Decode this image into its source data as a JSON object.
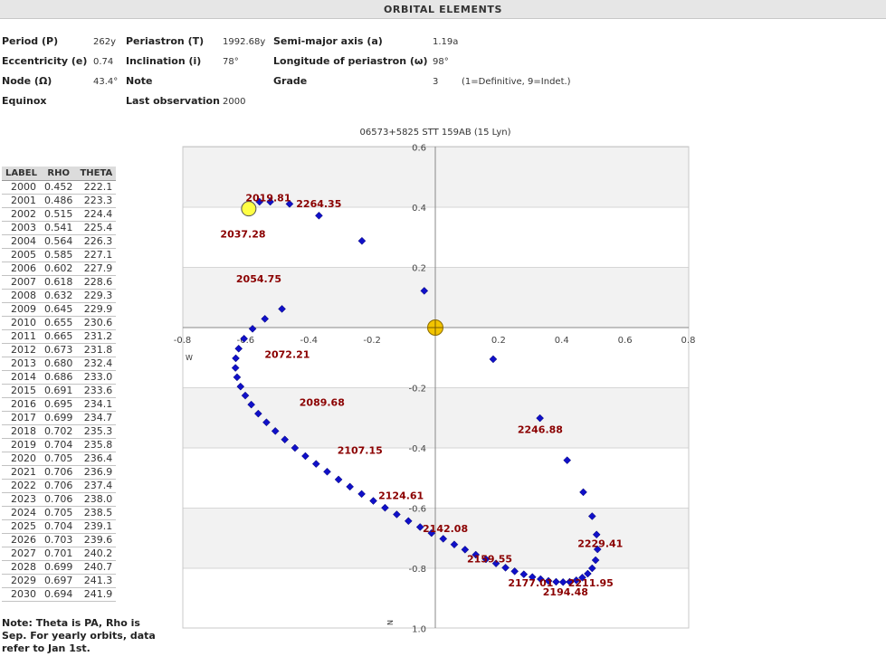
{
  "header": {
    "title": "ORBITAL ELEMENTS"
  },
  "elements": {
    "period_label": "Period (P)",
    "period_value": "262y",
    "periastron_label": "Periastron (T)",
    "periastron_value": "1992.68y",
    "semimajor_label": "Semi-major axis (a)",
    "semimajor_value": "1.19a",
    "ecc_label": "Eccentricity (e)",
    "ecc_value": "0.74",
    "incl_label": "Inclination (i)",
    "incl_value": "78°",
    "longperi_label": "Longitude of periastron (ω)",
    "longperi_value": "98°",
    "node_label": "Node (Ω)",
    "node_value": "43.4°",
    "note_label": "Note",
    "grade_label": "Grade",
    "grade_value": "3",
    "grade_note": "(1=Definitive, 9=Indet.)",
    "equinox_label": "Equinox",
    "lastobs_label": "Last observation",
    "lastobs_value": "2000"
  },
  "ephemeris": {
    "columns": [
      "LABEL",
      "RHO",
      "THETA"
    ],
    "rows": [
      [
        "2000",
        "0.452",
        "222.1"
      ],
      [
        "2001",
        "0.486",
        "223.3"
      ],
      [
        "2002",
        "0.515",
        "224.4"
      ],
      [
        "2003",
        "0.541",
        "225.4"
      ],
      [
        "2004",
        "0.564",
        "226.3"
      ],
      [
        "2005",
        "0.585",
        "227.1"
      ],
      [
        "2006",
        "0.602",
        "227.9"
      ],
      [
        "2007",
        "0.618",
        "228.6"
      ],
      [
        "2008",
        "0.632",
        "229.3"
      ],
      [
        "2009",
        "0.645",
        "229.9"
      ],
      [
        "2010",
        "0.655",
        "230.6"
      ],
      [
        "2011",
        "0.665",
        "231.2"
      ],
      [
        "2012",
        "0.673",
        "231.8"
      ],
      [
        "2013",
        "0.680",
        "232.4"
      ],
      [
        "2014",
        "0.686",
        "233.0"
      ],
      [
        "2015",
        "0.691",
        "233.6"
      ],
      [
        "2016",
        "0.695",
        "234.1"
      ],
      [
        "2017",
        "0.699",
        "234.7"
      ],
      [
        "2018",
        "0.702",
        "235.3"
      ],
      [
        "2019",
        "0.704",
        "235.8"
      ],
      [
        "2020",
        "0.705",
        "236.4"
      ],
      [
        "2021",
        "0.706",
        "236.9"
      ],
      [
        "2022",
        "0.706",
        "237.4"
      ],
      [
        "2023",
        "0.706",
        "238.0"
      ],
      [
        "2024",
        "0.705",
        "238.5"
      ],
      [
        "2025",
        "0.704",
        "239.1"
      ],
      [
        "2026",
        "0.703",
        "239.6"
      ],
      [
        "2027",
        "0.701",
        "240.2"
      ],
      [
        "2028",
        "0.699",
        "240.7"
      ],
      [
        "2029",
        "0.697",
        "241.3"
      ],
      [
        "2030",
        "0.694",
        "241.9"
      ]
    ]
  },
  "note": "Note: Theta is PA, Rho is Sep. For yearly orbits, data refer to Jan 1st.",
  "chart_data": {
    "type": "scatter",
    "title": "06573+5825 STT 159AB (15 Lyn)",
    "xlim": [
      -0.8,
      0.8
    ],
    "ylim": [
      1.0,
      -0.6
    ],
    "x_ticks": [
      -0.8,
      -0.6,
      -0.4,
      -0.2,
      0.2,
      0.4,
      0.6,
      0.8
    ],
    "y_ticks": [
      -0.6,
      0.4,
      0.2,
      -0.2,
      -0.4,
      -0.6,
      -0.8,
      1.0
    ],
    "x_tick_labels": [
      "-0.8",
      "-0.6",
      "-0.4",
      "-0.2",
      "0.2",
      "0.4",
      "0.6",
      "0.8"
    ],
    "y_tick_labels": [
      "0.6",
      "0.4",
      "0.2",
      "-0.2",
      "-0.4",
      "-0.6",
      "-0.8",
      "1.0"
    ],
    "axis_direction_labels": {
      "west": "W",
      "north": "N"
    },
    "grid": "alternating horizontal bands",
    "series": [
      {
        "points": [
          [
            -0.556,
            0.418
          ],
          [
            -0.522,
            0.418
          ],
          [
            -0.461,
            0.411
          ],
          [
            -0.368,
            0.372
          ],
          [
            -0.232,
            0.288
          ],
          [
            -0.035,
            0.122
          ],
          [
            0.183,
            -0.105
          ],
          [
            0.331,
            -0.301
          ],
          [
            0.417,
            -0.441
          ],
          [
            0.468,
            -0.547
          ],
          [
            0.496,
            -0.627
          ],
          [
            0.51,
            -0.688
          ],
          [
            0.513,
            -0.737
          ],
          [
            0.507,
            -0.773
          ],
          [
            0.496,
            -0.8
          ],
          [
            0.482,
            -0.818
          ],
          [
            0.465,
            -0.831
          ],
          [
            0.446,
            -0.84
          ],
          [
            0.425,
            -0.845
          ],
          [
            0.404,
            -0.846
          ],
          [
            0.382,
            -0.845
          ],
          [
            0.358,
            -0.842
          ],
          [
            0.333,
            -0.836
          ],
          [
            0.307,
            -0.829
          ],
          [
            0.28,
            -0.82
          ],
          [
            0.251,
            -0.81
          ],
          [
            0.222,
            -0.798
          ],
          [
            0.192,
            -0.784
          ],
          [
            0.16,
            -0.77
          ],
          [
            0.128,
            -0.755
          ],
          [
            0.094,
            -0.738
          ],
          [
            0.06,
            -0.721
          ],
          [
            0.025,
            -0.702
          ],
          [
            -0.012,
            -0.683
          ],
          [
            -0.048,
            -0.663
          ],
          [
            -0.085,
            -0.643
          ],
          [
            -0.122,
            -0.621
          ],
          [
            -0.159,
            -0.599
          ],
          [
            -0.196,
            -0.576
          ],
          [
            -0.233,
            -0.553
          ],
          [
            -0.27,
            -0.529
          ],
          [
            -0.306,
            -0.505
          ],
          [
            -0.342,
            -0.479
          ],
          [
            -0.377,
            -0.453
          ],
          [
            -0.411,
            -0.427
          ],
          [
            -0.444,
            -0.4
          ],
          [
            -0.476,
            -0.372
          ],
          [
            -0.506,
            -0.344
          ],
          [
            -0.534,
            -0.315
          ],
          [
            -0.56,
            -0.286
          ],
          [
            -0.582,
            -0.256
          ],
          [
            -0.601,
            -0.226
          ],
          [
            -0.616,
            -0.196
          ],
          [
            -0.627,
            -0.165
          ],
          [
            -0.632,
            -0.134
          ],
          [
            -0.631,
            -0.102
          ],
          [
            -0.622,
            -0.07
          ],
          [
            -0.605,
            -0.037
          ],
          [
            -0.578,
            -0.004
          ],
          [
            -0.539,
            0.029
          ],
          [
            -0.485,
            0.062
          ]
        ]
      }
    ],
    "marker_labels": [
      {
        "text": "2019.81",
        "x": -0.6,
        "y": 0.42
      },
      {
        "text": "2264.35",
        "x": -0.44,
        "y": 0.4
      },
      {
        "text": "2037.28",
        "x": -0.68,
        "y": 0.3
      },
      {
        "text": "2054.75",
        "x": -0.63,
        "y": 0.15
      },
      {
        "text": "2072.21",
        "x": -0.54,
        "y": -0.1
      },
      {
        "text": "2089.68",
        "x": -0.43,
        "y": -0.26
      },
      {
        "text": "2107.15",
        "x": -0.31,
        "y": -0.42
      },
      {
        "text": "2124.61",
        "x": -0.18,
        "y": -0.57
      },
      {
        "text": "2142.08",
        "x": -0.04,
        "y": -0.68
      },
      {
        "text": "2159.55",
        "x": 0.1,
        "y": -0.78
      },
      {
        "text": "2177.01",
        "x": 0.23,
        "y": -0.86
      },
      {
        "text": "2194.48",
        "x": 0.34,
        "y": -0.89
      },
      {
        "text": "2211.95",
        "x": 0.42,
        "y": -0.86
      },
      {
        "text": "2229.41",
        "x": 0.45,
        "y": -0.73
      },
      {
        "text": "2246.88",
        "x": 0.26,
        "y": -0.35
      }
    ],
    "primary_star": [
      0.0,
      0.0
    ],
    "current_position": [
      -0.59,
      0.395
    ]
  }
}
